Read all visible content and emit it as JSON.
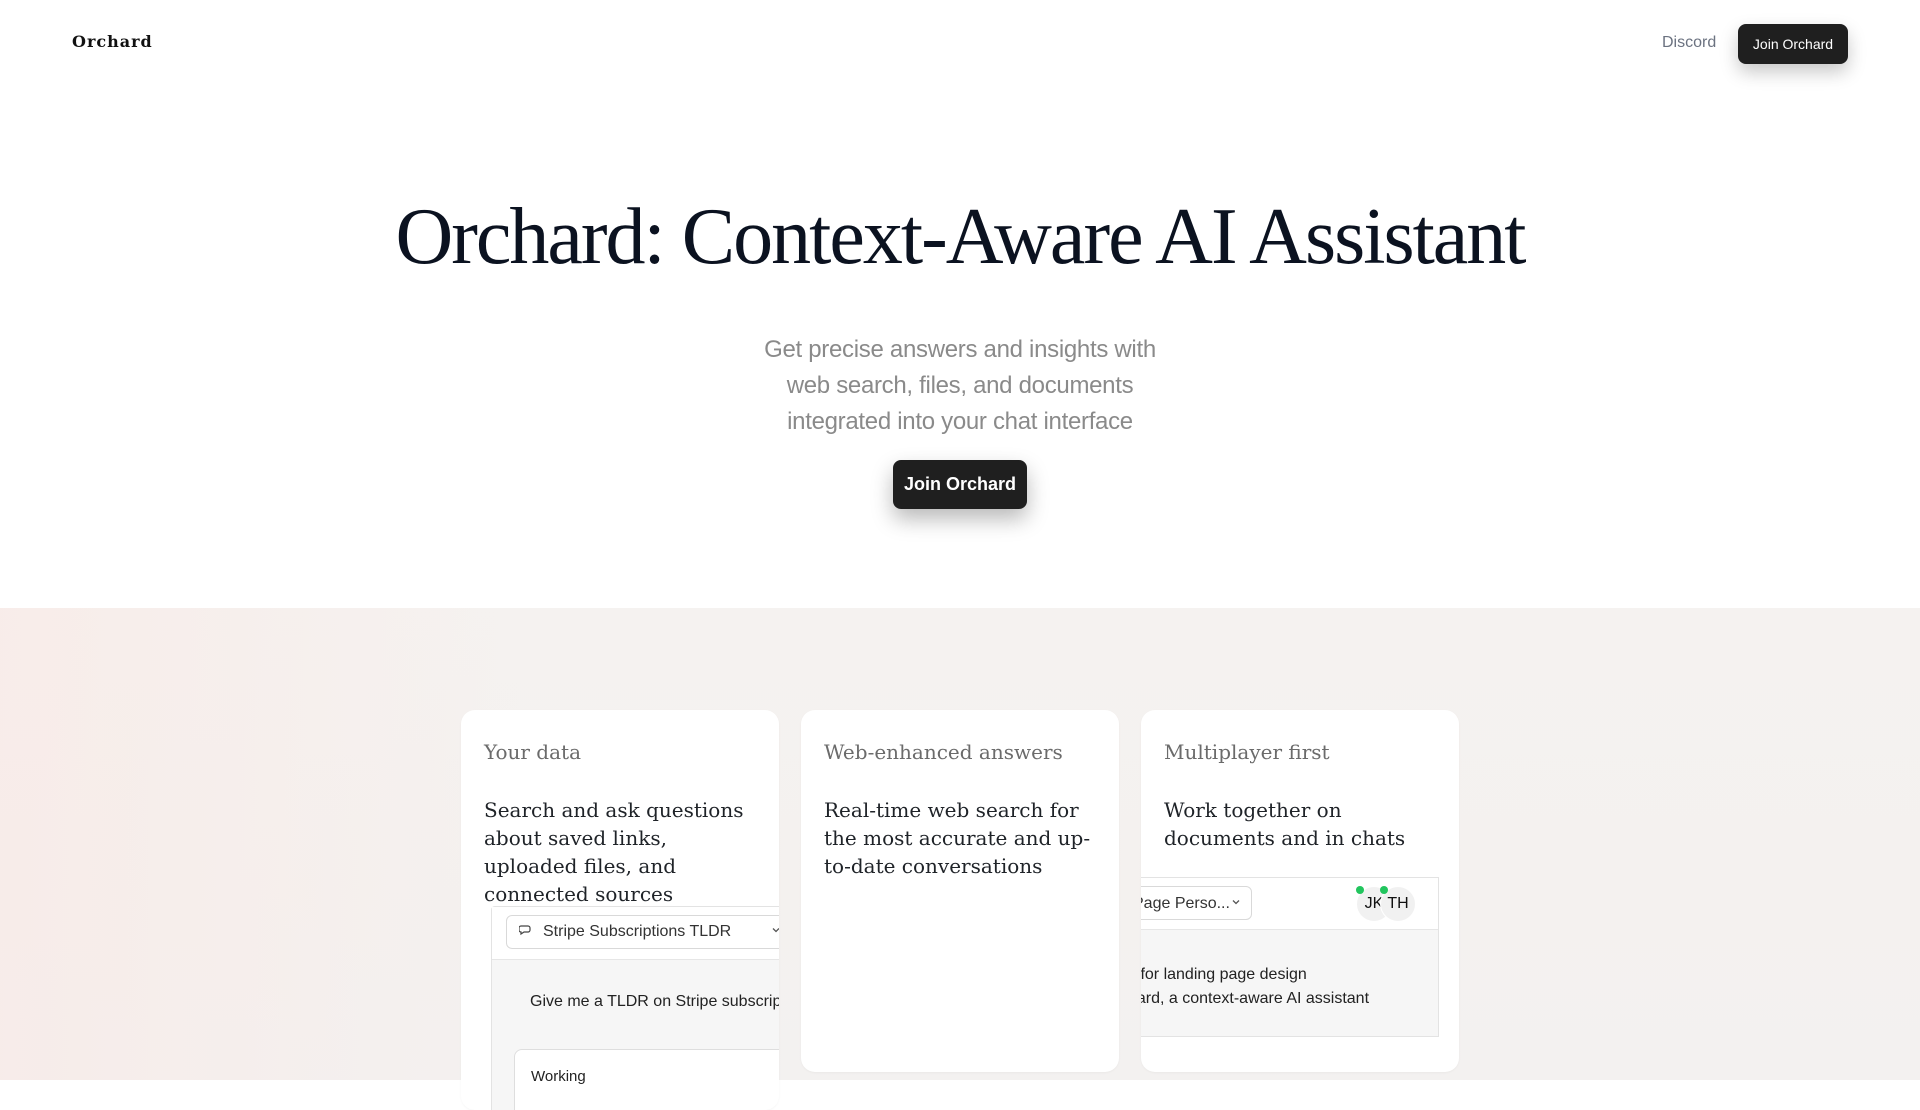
{
  "header": {
    "brand": "Orchard",
    "nav_link": "Discord",
    "cta_label": "Join Orchard"
  },
  "hero": {
    "title": "Orchard: Context-Aware AI Assistant",
    "subtitle_lines": [
      "Get precise answers and insights with",
      "web search, files, and documents",
      "integrated into your chat interface"
    ],
    "cta_label": "Join Orchard"
  },
  "features": [
    {
      "title": "Your data",
      "description": "Search and ask questions about saved links, uploaded files, and connected sources",
      "mock": {
        "select_value": "Stripe Subscriptions TLDR",
        "user_message": "Give me a TLDR on Stripe subscripti",
        "status_text": "Working"
      }
    },
    {
      "title": "Web-enhanced answers",
      "description": "Real-time web search for the most accurate and up-to-date conversations"
    },
    {
      "title": "Multiplayer first",
      "description": "Work together on documents and in chats",
      "mock": {
        "select_value": "Page Perso...",
        "avatars": [
          "JK",
          "TH"
        ],
        "lines": [
          "s for landing page design",
          "hard, a context-aware AI assistant"
        ]
      }
    }
  ],
  "icons": {
    "chat": "chat-bubbles-icon",
    "chevron": "chevron-down-icon"
  },
  "colors": {
    "primary_button": "#1f1f1f",
    "presence_dot": "#22c55e",
    "band_background": "#f4f1ef"
  }
}
